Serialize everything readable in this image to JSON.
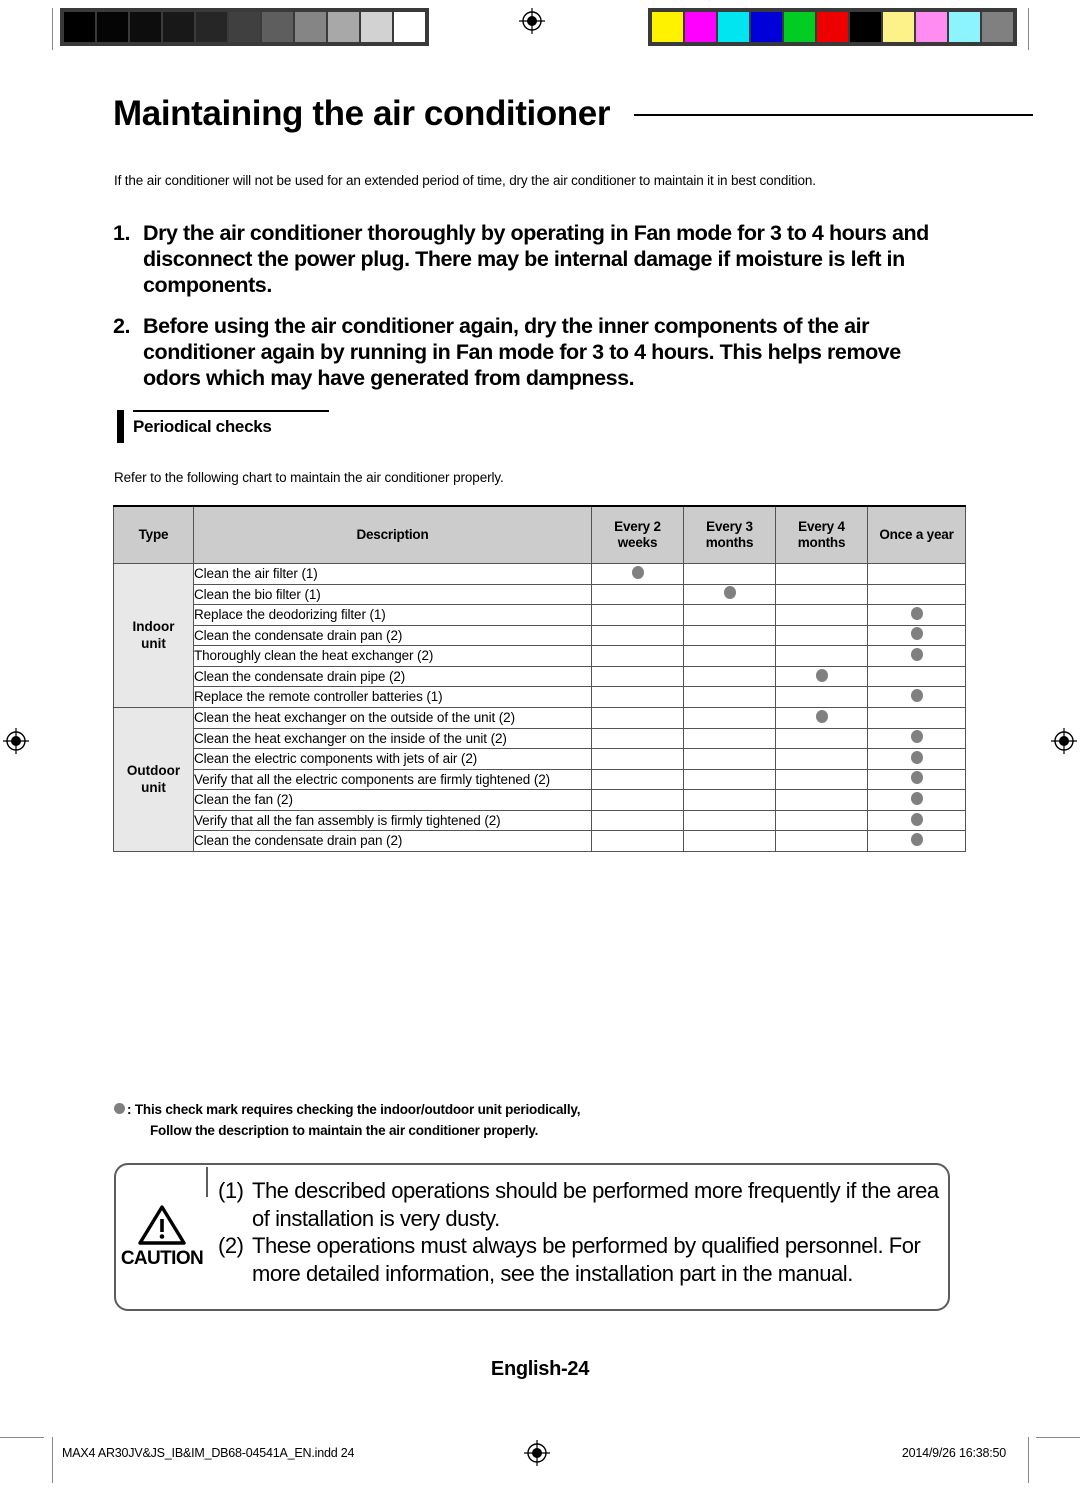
{
  "document": {
    "title": "Maintaining the air conditioner",
    "intro": "If the air conditioner will not be used for an extended period of time, dry the air conditioner to maintain it in best condition.",
    "steps": [
      {
        "num": "1.",
        "text": "Dry the air conditioner thoroughly by operating in Fan mode for 3 to 4 hours and disconnect the power plug. There may be internal damage if moisture is left in components."
      },
      {
        "num": "2.",
        "text": "Before using the air conditioner again, dry the inner components of the air conditioner again by running in Fan mode for 3 to 4 hours. This helps remove odors which may have generated from dampness."
      }
    ],
    "section": {
      "heading": "Periodical checks",
      "note": "Refer to the following chart to maintain the air conditioner properly."
    },
    "page_label": "English-24"
  },
  "table": {
    "headers": {
      "type": "Type",
      "description": "Description",
      "p1_l1": "Every 2",
      "p1_l2": "weeks",
      "p2_l1": "Every 3",
      "p2_l2": "months",
      "p3_l1": "Every 4",
      "p3_l2": "months",
      "p4": "Once a year"
    },
    "groups": [
      {
        "type_l1": "Indoor",
        "type_l2": "unit",
        "rows": [
          {
            "description": "Clean the air filter (1)",
            "marks": [
              true,
              false,
              false,
              false
            ]
          },
          {
            "description": "Clean the bio filter (1)",
            "marks": [
              false,
              true,
              false,
              false
            ]
          },
          {
            "description": "Replace the deodorizing filter (1)",
            "marks": [
              false,
              false,
              false,
              true
            ]
          },
          {
            "description": "Clean the condensate drain pan (2)",
            "marks": [
              false,
              false,
              false,
              true
            ]
          },
          {
            "description": "Thoroughly clean the heat exchanger (2)",
            "marks": [
              false,
              false,
              false,
              true
            ]
          },
          {
            "description": "Clean the condensate drain pipe (2)",
            "marks": [
              false,
              false,
              true,
              false
            ]
          },
          {
            "description": "Replace the remote controller batteries (1)",
            "marks": [
              false,
              false,
              false,
              true
            ]
          }
        ]
      },
      {
        "type_l1": "Outdoor",
        "type_l2": "unit",
        "rows": [
          {
            "description": "Clean the heat exchanger on the outside of the unit (2)",
            "marks": [
              false,
              false,
              true,
              false
            ]
          },
          {
            "description": "Clean the heat exchanger on the inside of the unit (2)",
            "marks": [
              false,
              false,
              false,
              true
            ]
          },
          {
            "description": "Clean the electric components with jets of air (2)",
            "marks": [
              false,
              false,
              false,
              true
            ]
          },
          {
            "description": "Verify that all the electric components are firmly tightened (2)",
            "marks": [
              false,
              false,
              false,
              true
            ]
          },
          {
            "description": "Clean the fan (2)",
            "marks": [
              false,
              false,
              false,
              true
            ]
          },
          {
            "description": "Verify that all the fan assembly is firmly tightened (2)",
            "marks": [
              false,
              false,
              false,
              true
            ]
          },
          {
            "description": "Clean the condensate drain pan (2)",
            "marks": [
              false,
              false,
              false,
              true
            ]
          }
        ]
      }
    ]
  },
  "footnote": {
    "line1": ": This check mark requires checking the indoor/outdoor unit periodically,",
    "line2": "Follow  the description to maintain the air conditioner properly."
  },
  "caution": {
    "label": "CAUTION",
    "items": [
      {
        "num": "(1)",
        "text": "The described operations should be performed more frequently if the area of installation is very dusty."
      },
      {
        "num": "(2)",
        "text": "These operations must always be performed by qualified personnel. For more detailed information, see the installation part in the manual."
      }
    ]
  },
  "slug": {
    "left": "MAX4 AR30JV&JS_IB&IM_DB68-04541A_EN.indd   24",
    "right": "2014/9/26   16:38:50"
  },
  "prepress": {
    "gray_patches": [
      "#000000",
      "#050505",
      "#0d0d0d",
      "#181818",
      "#262626",
      "#404040",
      "#5e5e5e",
      "#858585",
      "#a8a8a8",
      "#d2d2d2",
      "#ffffff"
    ],
    "color_patches": [
      "#fff200",
      "#ff00ff",
      "#00e5f0",
      "#0000d8",
      "#00cc22",
      "#ef0000",
      "#000000",
      "#fdf18a",
      "#ff8cf0",
      "#8cf4ff",
      "#808080"
    ]
  }
}
